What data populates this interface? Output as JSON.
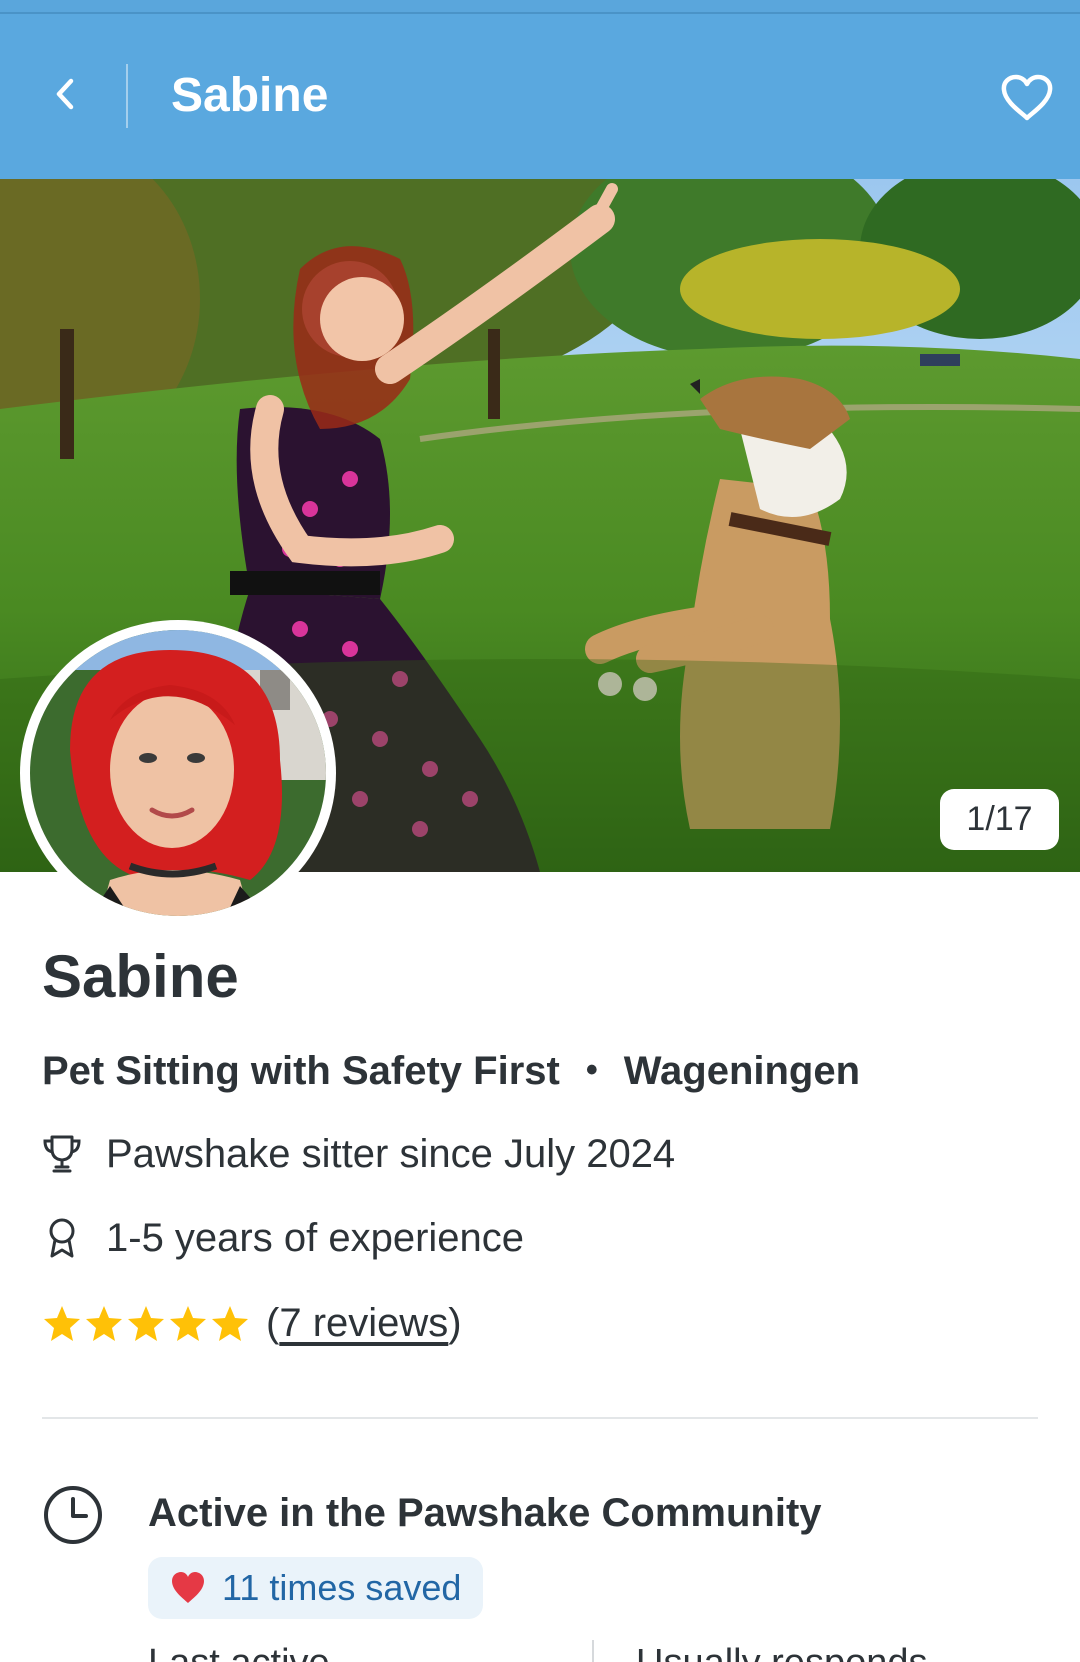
{
  "header": {
    "title": "Sabine",
    "back_icon": "chevron-left-icon",
    "favorite_icon": "heart-outline-icon"
  },
  "hero": {
    "photo_counter": "1/17"
  },
  "profile": {
    "name": "Sabine",
    "tagline": "Pet Sitting with Safety First",
    "separator": "•",
    "location": "Wageningen",
    "sitter_since": "Pawshake sitter since July 2024",
    "experience": "1-5 years of experience",
    "rating": {
      "stars": 5,
      "max_stars": 5,
      "reviews_open": "(",
      "reviews_label": "7 reviews",
      "reviews_close": ")"
    }
  },
  "community": {
    "title": "Active in the Pawshake Community",
    "saved_label": "11 times saved",
    "last_active_label": "Last active",
    "responds_label": "Usually responds"
  },
  "colors": {
    "header_bg": "#5aa8df",
    "text": "#2d3338",
    "star": "#ffc107",
    "badge_bg": "#eaf3fa",
    "badge_text": "#2266a5",
    "heart": "#e53945"
  }
}
